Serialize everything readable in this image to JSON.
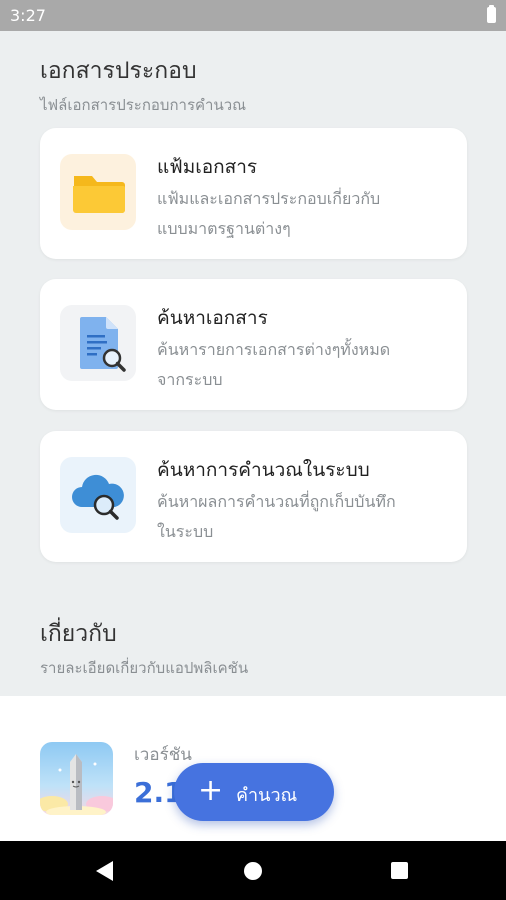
{
  "status": {
    "time": "3:27"
  },
  "documents_section": {
    "title": "เอกสารประกอบ",
    "subtitle": "ไฟล์เอกสารประกอบการคำนวณ"
  },
  "cards": [
    {
      "title": "แฟ้มเอกสาร",
      "desc_line1": "แฟ้มและเอกสารประกอบเกี่ยวกับ",
      "desc_line2": "แบบมาตรฐานต่างๆ",
      "icon": "folder-icon",
      "icon_bg": "#fdf1de"
    },
    {
      "title": "ค้นหาเอกสาร",
      "desc_line1": "ค้นหารายการเอกสารต่างๆทั้งหมด",
      "desc_line2": "จากระบบ",
      "icon": "document-search-icon",
      "icon_bg": "#f2f3f5"
    },
    {
      "title": "ค้นหาการคำนวณในระบบ",
      "desc_line1": "ค้นหาผลการคำนวณที่ถูกเก็บบันทึก",
      "desc_line2": "ในระบบ",
      "icon": "cloud-search-icon",
      "icon_bg": "#eaf3fb"
    }
  ],
  "about_section": {
    "title": "เกี่ยวกับ",
    "subtitle": "รายละเอียดเกี่ยวกับแอปพลิเคชัน",
    "version_label": "เวอร์ชัน",
    "version_value": "2.1."
  },
  "fab": {
    "label": "คำนวณ",
    "icon": "plus-icon"
  },
  "colors": {
    "accent": "#4673e0",
    "version_text": "#3b6fd8",
    "background": "#eceff0"
  }
}
